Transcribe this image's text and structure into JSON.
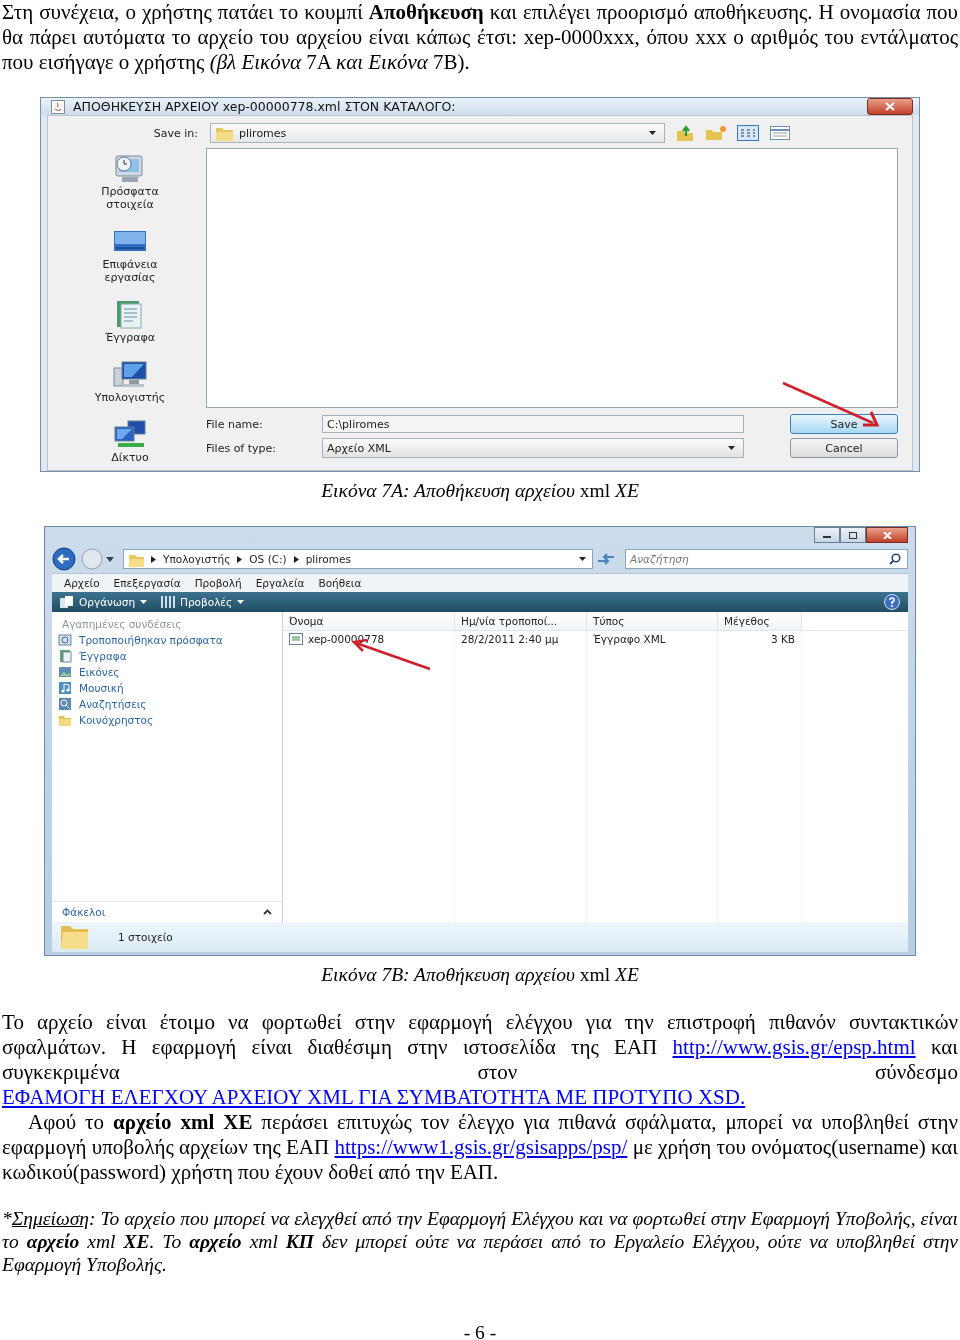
{
  "intro": "Στη συνέχεια, ο χρήστης πατάει το κουμπί **Αποθήκευση** και επιλέγει προορισμό αποθήκευσης. Η ονομασία που θα πάρει αυτόματα το αρχείο του αρχείου είναι κάπως έτσι: xep-0000xxx, όπου xxx ο αριθμός του εντάλματος που εισήγαγε ο χρήστης *(βλ Εικόνα* 7Α *και Εικόνα* 7Β).",
  "save_dialog": {
    "title": "ΑΠΟΘΗΚΕΥΣΗ ΑΡΧΕΙΟΥ xep-00000778.xml ΣΤΟΝ ΚΑΤΑΛΟΓΟ:",
    "save_in": {
      "label": "Save in:",
      "value": "pliromes"
    },
    "places": [
      {
        "label": "Πρόσφατα στοιχεία",
        "kind": "recent"
      },
      {
        "label": "Επιφάνεια εργασίας",
        "kind": "desktop"
      },
      {
        "label": "Έγγραφα",
        "kind": "documents"
      },
      {
        "label": "Υπολογιστής",
        "kind": "computer"
      },
      {
        "label": "Δίκτυο",
        "kind": "network"
      }
    ],
    "file_name": {
      "label": "File name:",
      "value": "C:\\pliromes"
    },
    "file_type": {
      "label": "Files of type:",
      "value": "Αρχείο XML"
    },
    "buttons": [
      {
        "label": "Save",
        "focused": true
      },
      {
        "label": "Cancel",
        "focused": false
      }
    ]
  },
  "caption_a": "*Εικόνα 7Α: Αποθήκευση αρχείου* xml *ΧΕ*",
  "explorer": {
    "breadcrumb": [
      "Υπολογιστής",
      "OS (C:)",
      "pliromes"
    ],
    "search": {
      "placeholder": "Αναζήτηση"
    },
    "menu": [
      "Αρχείο",
      "Επεξεργασία",
      "Προβολή",
      "Εργαλεία",
      "Βοήθεια"
    ],
    "toolbar": [
      "Οργάνωση",
      "Προβολές"
    ],
    "favorites_heading": "Αγαπημένες συνδέσεις",
    "favorites": [
      {
        "label": "Τροποποιήθηκαν πρόσφατα",
        "kind": "recent"
      },
      {
        "label": "Έγγραφα",
        "kind": "documents"
      },
      {
        "label": "Εικόνες",
        "kind": "pictures"
      },
      {
        "label": "Μουσική",
        "kind": "music"
      },
      {
        "label": "Αναζητήσεις",
        "kind": "searches"
      },
      {
        "label": "Κοινόχρηστος",
        "kind": "folder"
      }
    ],
    "folders_label": "Φάκελοι",
    "columns": [
      "Όνομα",
      "Ημ/νία τροποποί...",
      "Τύπος",
      "Μέγεθος"
    ],
    "rows": [
      [
        "xep-00000778",
        "28/2/2011 2:40 μμ",
        "Έγγραφο XML",
        "3 KB"
      ]
    ],
    "status": "1 στοιχείο"
  },
  "caption_b": "*Εικόνα 7Β: Αποθήκευση αρχείου* xml *ΧΕ*",
  "paragraphs": [
    [
      {
        "text": "Το αρχείο είναι έτοιμο να φορτωθεί στην εφαρμογή ελέγχου για την επιστροφή πιθανόν συντακτικών σφαλμάτων. Η εφαρμογή είναι διαθέσιμη στην ιστοσελίδα της ΕΑΠ "
      },
      {
        "link": "http://www.gsis.gr/epsp.html"
      },
      {
        "text": " και συγκεκριμένα στον σύνδεσμο "
      },
      {
        "link": "ΕΦΑΜΟΓΗ ΕΛΕΓΧΟΥ ΑΡΧΕΙΟΥ XML ΓΙΑ ΣΥΜΒΑΤΟΤΗΤΑ ΜΕ ΠΡΟΤΥΠΟ XSD."
      }
    ],
    [
      {
        "text": "Αφού το **αρχείο xml ΧΕ** περάσει επιτυχώς τον έλεγχο για πιθανά σφάλματα, μπορεί να υποβληθεί στην εφαρμογή υποβολής αρχείων της ΕΑΠ "
      },
      {
        "link": "https://www1.gsis.gr/gsisapps/psp/"
      },
      {
        "text": " με χρήση του ονόματος(username) και κωδικού(password) χρήστη που έχουν δοθεί από την ΕΑΠ."
      }
    ]
  ],
  "note": {
    "marker": "*",
    "label": "Σημείωση",
    "text": ": Το αρχείο που μπορεί να ελεγχθεί από την Εφαρμογή Ελέγχου και να φορτωθεί στην Εφαρμογή Υποβολής, είναι το **αρχείο** xml **ΧΕ**. Το **αρχείο** xml **ΚΠ** δεν μπορεί ούτε να περάσει από το Εργαλείο Ελέγχου, ούτε να υποβληθεί στην Εφαρμογή Υποβολής."
  },
  "page_number": "- 6 -"
}
